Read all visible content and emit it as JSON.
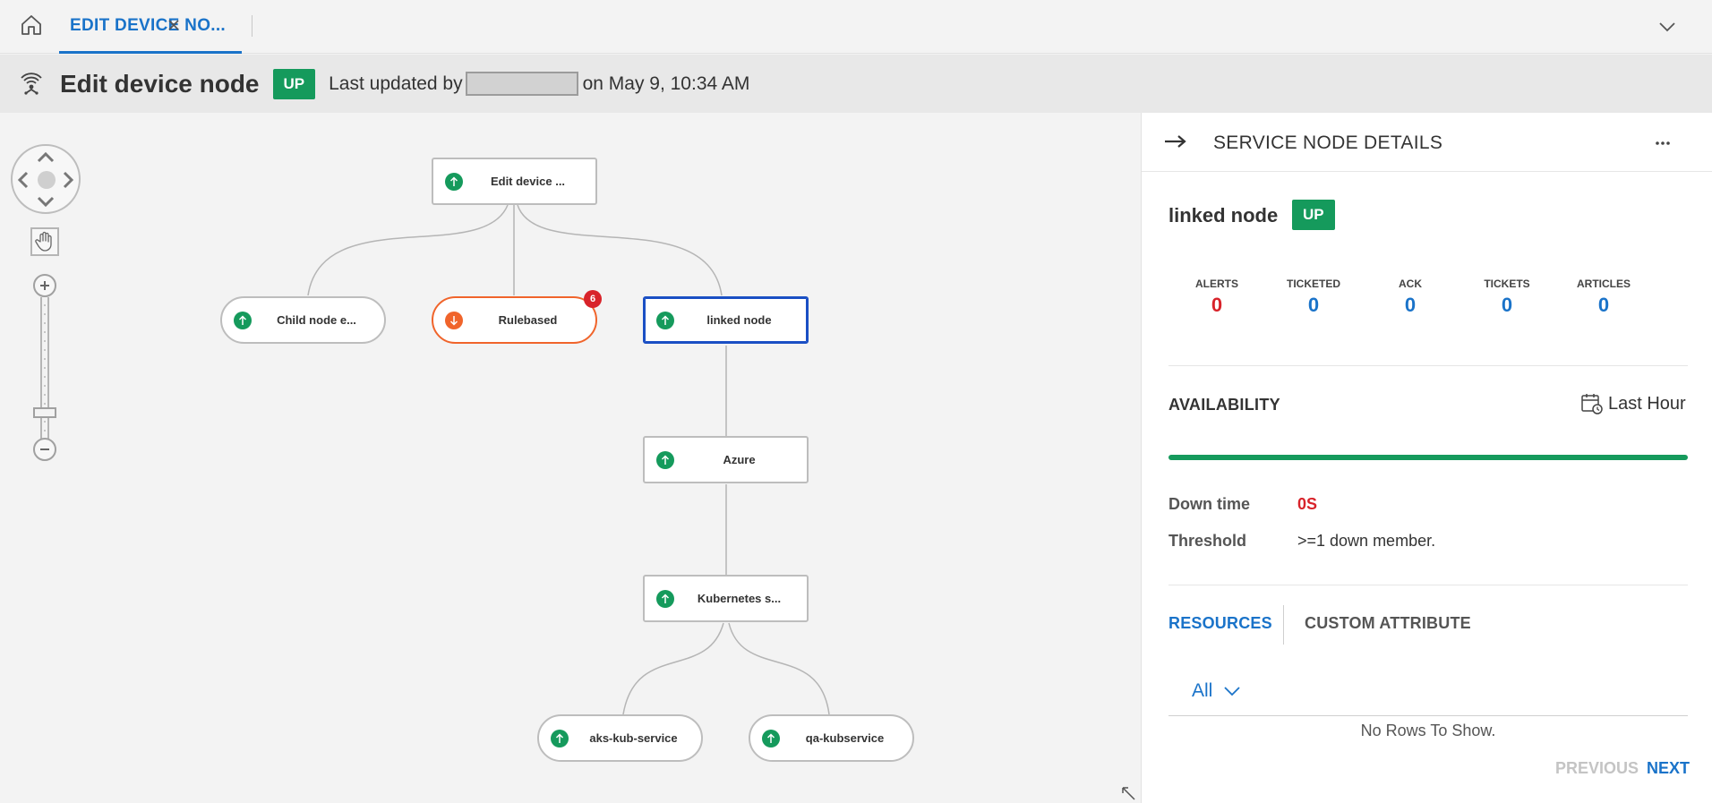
{
  "tabbar": {
    "home_icon": "home-icon",
    "active_tab_label": "EDIT DEVICE NO...",
    "close_icon": "close-icon",
    "dropdown_icon": "chevron-down-icon"
  },
  "header": {
    "icon": "service-map-icon",
    "title": "Edit device node",
    "status": "UP",
    "updated_prefix": "Last updated by",
    "updated_suffix": "on May 9, 10:34 AM"
  },
  "canvas": {
    "controls": {
      "pan_icon": "hand-icon",
      "zoom_in_icon": "plus-icon",
      "zoom_out_icon": "minus-icon"
    },
    "nodes": [
      {
        "id": "root",
        "label": "Edit device ...",
        "status": "up",
        "shape": "rect"
      },
      {
        "id": "child",
        "label": "Child node e...",
        "status": "up",
        "shape": "pill"
      },
      {
        "id": "rulebased",
        "label": "Rulebased",
        "status": "down",
        "shape": "pill",
        "badge": "6"
      },
      {
        "id": "linked",
        "label": "linked node",
        "status": "up",
        "shape": "rect",
        "selected": true
      },
      {
        "id": "azure",
        "label": "Azure",
        "status": "up",
        "shape": "rect"
      },
      {
        "id": "kube",
        "label": "Kubernetes s...",
        "status": "up",
        "shape": "rect"
      },
      {
        "id": "aks",
        "label": "aks-kub-service",
        "status": "up",
        "shape": "pill"
      },
      {
        "id": "qa",
        "label": "qa-kubservice",
        "status": "up",
        "shape": "pill"
      }
    ]
  },
  "panel": {
    "collapse_icon": "arrow-right-icon",
    "title": "SERVICE NODE DETAILS",
    "more_icon": "more-horizontal-icon",
    "node_name": "linked node",
    "node_status": "UP",
    "stats": [
      {
        "label": "ALERTS",
        "value": "0",
        "color": "#d8232a"
      },
      {
        "label": "TICKETED",
        "value": "0",
        "color": "#1a73c9"
      },
      {
        "label": "ACK",
        "value": "0",
        "color": "#1a73c9"
      },
      {
        "label": "TICKETS",
        "value": "0",
        "color": "#1a73c9"
      },
      {
        "label": "ARTICLES",
        "value": "0",
        "color": "#1a73c9"
      }
    ],
    "availability": {
      "title": "AVAILABILITY",
      "range_icon": "calendar-clock-icon",
      "range_label": "Last Hour",
      "bar_color": "#159a5c"
    },
    "down_time": {
      "label": "Down time",
      "value": "0S"
    },
    "threshold": {
      "label": "Threshold",
      "value": ">=1 down member."
    },
    "tabs": {
      "resources": "RESOURCES",
      "custom_attribute": "CUSTOM ATTRIBUTE"
    },
    "filter": {
      "value": "All",
      "icon": "chevron-down-icon"
    },
    "empty_text": "No Rows To Show.",
    "pager": {
      "previous": "PREVIOUS",
      "next": "NEXT"
    }
  },
  "colors": {
    "accent": "#1a73c9",
    "status_up": "#159a5c",
    "status_down": "#f0642b",
    "alert_red": "#d8232a",
    "selected_border": "#1a4fc4"
  }
}
